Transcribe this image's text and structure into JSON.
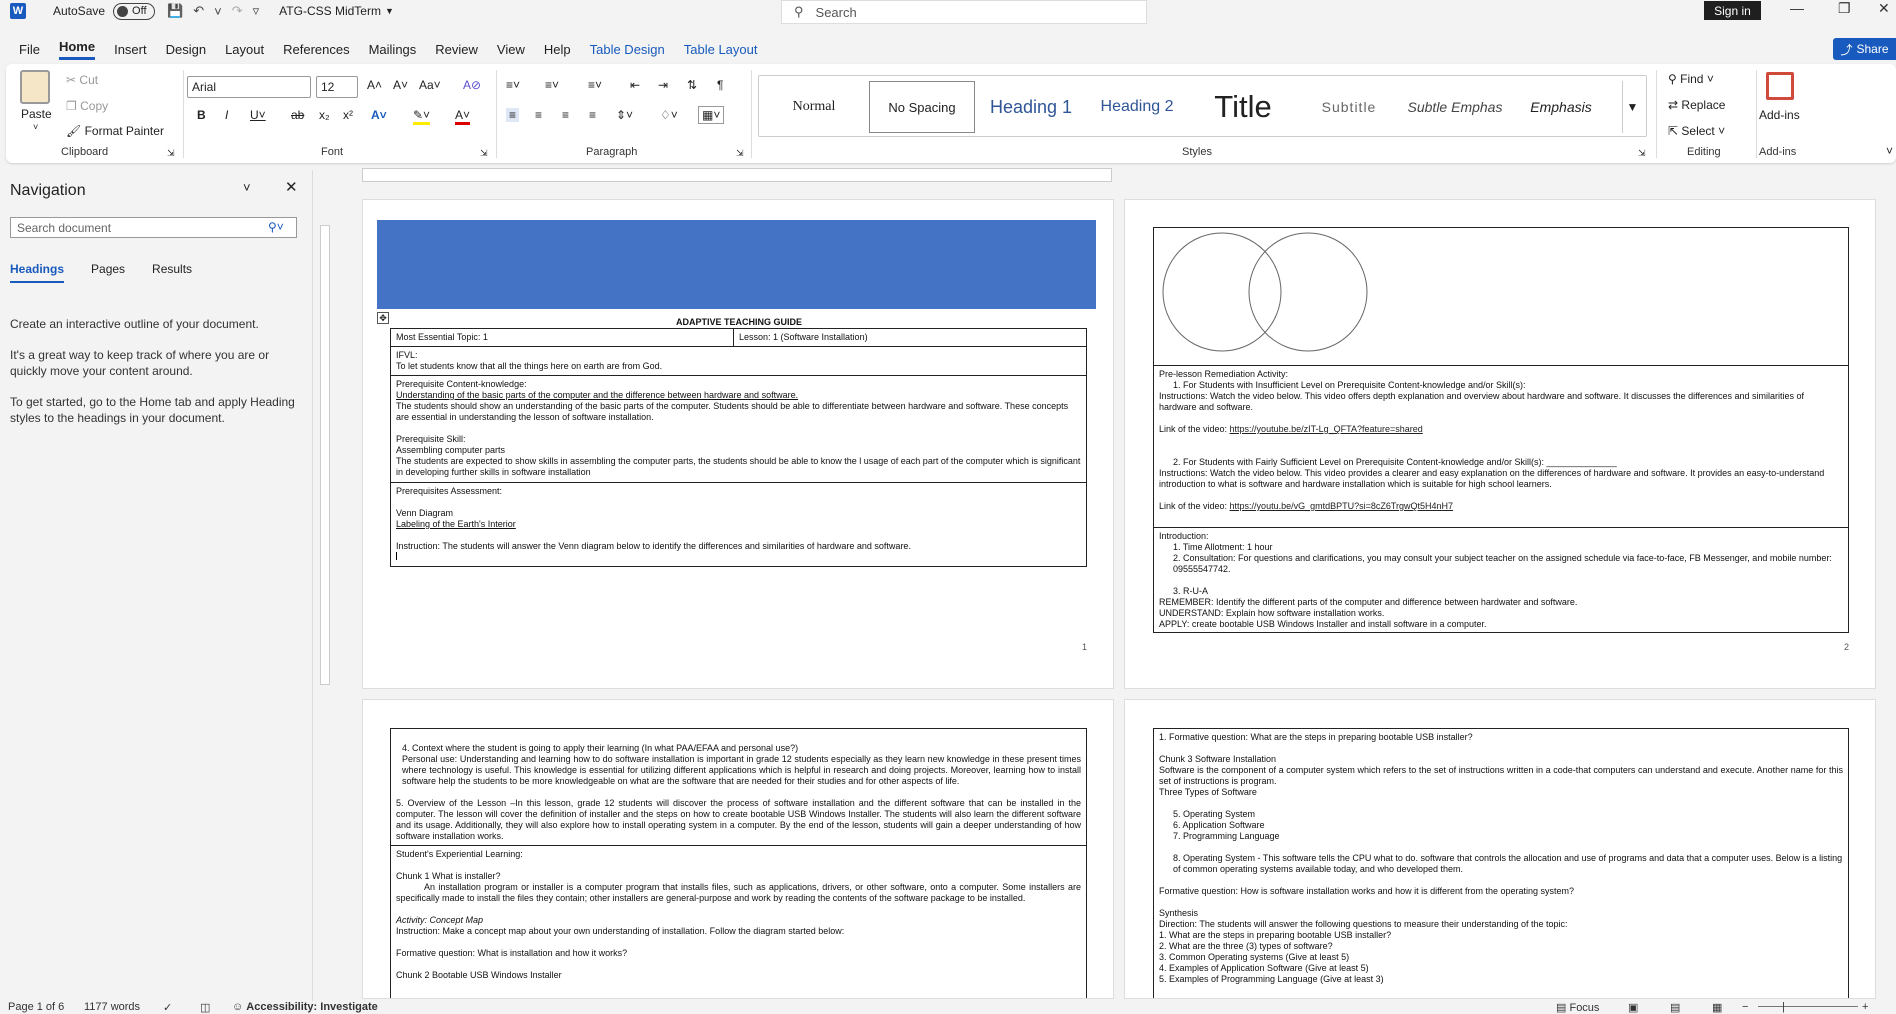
{
  "app": {
    "autosave": "AutoSave",
    "autosave_state": "Off",
    "doc_title": "ATG-CSS MidTerm",
    "search": "Search",
    "signin": "Sign in",
    "share": "Share"
  },
  "menu": [
    "File",
    "Home",
    "Insert",
    "Design",
    "Layout",
    "References",
    "Mailings",
    "Review",
    "View",
    "Help",
    "Table Design",
    "Table Layout"
  ],
  "ribbon": {
    "paste": "Paste",
    "cut": "Cut",
    "copy": "Copy",
    "format_painter": "Format Painter",
    "clipboard": "Clipboard",
    "font_name": "Arial",
    "font_size": "12",
    "font": "Font",
    "paragraph": "Paragraph",
    "styles_label": "Styles",
    "styles": [
      "Normal",
      "No Spacing",
      "Heading 1",
      "Heading 2",
      "Title",
      "Subtitle",
      "Subtle Emphas",
      "Emphasis"
    ],
    "find": "Find",
    "replace": "Replace",
    "select": "Select",
    "editing": "Editing",
    "addins": "Add-ins",
    "addins_group": "Add-ins"
  },
  "nav": {
    "title": "Navigation",
    "search_placeholder": "Search document",
    "tabs": [
      "Headings",
      "Pages",
      "Results"
    ],
    "p1": "Create an interactive outline of your document.",
    "p2": "It's a great way to keep track of where you are or quickly move your content around.",
    "p3": "To get started, go to the Home tab and apply Heading styles to the headings in your document."
  },
  "page1": {
    "heading": "ADAPTIVE TEACHING GUIDE",
    "topic": "Most Essential Topic: 1",
    "lesson": "Lesson: 1 (Software Installation)",
    "ifvl_label": "IFVL:",
    "ifvl": "To let students know that all the things here on earth are from God.",
    "pck_label": "Prerequisite Content-knowledge:",
    "pck_u": "Understanding of the basic parts of the computer and the difference between hardware and software.",
    "pck": "The students should show an understanding of the basic parts of the computer. Students should be able to differentiate between hardware and software. These concepts are essential in understanding the lesson of software installation.",
    "ps_label": "Prerequisite Skill:",
    "ps1": "Assembling computer parts",
    "ps2": "The students are expected to show skills in assembling the computer parts, the students should be able to know the l usage of each part of the computer which is significant in developing further skills in software installation",
    "pa_label": "Prerequisites Assessment:",
    "pa1": "Venn Diagram",
    "pa2": "Labeling of the Earth's Interior",
    "pa3": "Instruction: The students will answer the Venn diagram below to identify the differences and similarities of hardware and software.",
    "num": "1"
  },
  "page2": {
    "prl": "Pre-lesson Remediation Activity:",
    "s1": "1.   For Students with Insufficient Level on Prerequisite Content-knowledge and/or Skill(s):",
    "s1i": "Instructions: Watch the video below. This video offers depth explanation and overview about hardware and software. It discusses the differences and similarities of hardware and software.",
    "s1l": "Link of the video: ",
    "s1u": "https://youtube.be/zIT-Lg_QFTA?feature=shared",
    "s2": "2.   For Students with Fairly Sufficient Level on Prerequisite Content-knowledge and/or Skill(s): ______________",
    "s2i": "Instructions: Watch the video below. This video provides a clearer and easy explanation on the differences of hardware and software. It provides an easy-to-understand introduction to what is software and hardware installation which is suitable for high school learners.",
    "s2l": "Link of the video: ",
    "s2u": "https://youtu.be/vG_gmtdBPTU?si=8cZ6TrgwQt5H4nH7",
    "intro": "Introduction:",
    "i1": "1.   Time Allotment: 1 hour",
    "i2": "2.   Consultation: For questions and clarifications, you may consult your subject teacher on the assigned schedule via face-to-face, FB Messenger, and mobile number: 09555547742.",
    "i3": "3.   R-U-A",
    "rem": "REMEMBER: Identify the different parts of the computer and difference between hardwater and software.",
    "und": "UNDERSTAND: Explain how software installation works.",
    "app": "APPLY: create bootable USB Windows Installer and install software in a computer.",
    "num": "2"
  },
  "page3": {
    "c4": "4.   Context where the student is going to apply their learning (In what PAA/EFAA and personal use?)",
    "c4t": "Personal use: Understanding and learning how to do software installation is important in grade 12 students especially as they learn new knowledge in these present times where technology is useful. This knowledge is essential for utilizing different applications which is helpful in research and doing projects. Moreover, learning how to install software help the students to be more knowledgeable on what are the software that are needed for their studies and for other aspects of life.",
    "c5": "5. Overview of the Lesson –In this lesson, grade 12 students will discover the process of software installation and the different software that can be installed in the computer.  The lesson will cover the definition of installer and the steps on how to create bootable USB Windows Installer. The students will also learn the different software and its usage. Additionally, they will also explore how to install operating system in a computer. By the end of the lesson, students will gain a deeper understanding of how software installation works.",
    "sel": "Student's Experiential Learning:",
    "ch1": "Chunk 1 What is installer?",
    "ch1t": "An installation program or installer is a computer program that installs files, such as applications, drivers, or other software, onto a computer. Some installers are specifically made to install the files they contain; other installers are general-purpose and work by reading the contents of the software package to be installed.",
    "act": "Activity: Concept Map",
    "inst": "Instruction: Make a concept map about your own understanding of installation. Follow the diagram started below:",
    "fq": "Formative question: What is installation and how it works?",
    "ch2": "Chunk 2 Bootable USB Windows Installer"
  },
  "page4": {
    "fq1": "1. Formative question: What are the steps in preparing bootable USB installer?",
    "ch3": "Chunk 3 Software Installation",
    "ch3t": "Software is the component of a computer system which refers to the set of instructions written in a code-that computers can understand and execute.  Another name for this set of instructions is program.",
    "tts": "Three Types of Software",
    "l5": "5.   Operating System",
    "l6": "6.   Application Software",
    "l7": "7.   Programming Language",
    "l8": "8.   Operating System - This software tells the CPU what to do.  software that controls the allocation and use of programs and data that a computer uses.   Below is a listing of common operating systems available today, and who developed them.",
    "fq2": "Formative question: How is software installation works and how it is different from the operating system?",
    "syn": "Synthesis",
    "dir": "Direction: The students will answer the following questions to measure their understanding of the topic:",
    "q1": "1. What are the steps in preparing bootable USB installer?",
    "q2": "2. What are the three (3) types of software?",
    "q3": "3. Common Operating systems (Give at least 5)",
    "q4": "4. Examples of Application Software (Give at least 5)",
    "q5": "5. Examples of Programming Language (Give at least 3)"
  },
  "status": {
    "page": "Page 1 of 6",
    "words": "1177 words",
    "accessibility": "Accessibility: Investigate",
    "focus": "Focus"
  }
}
